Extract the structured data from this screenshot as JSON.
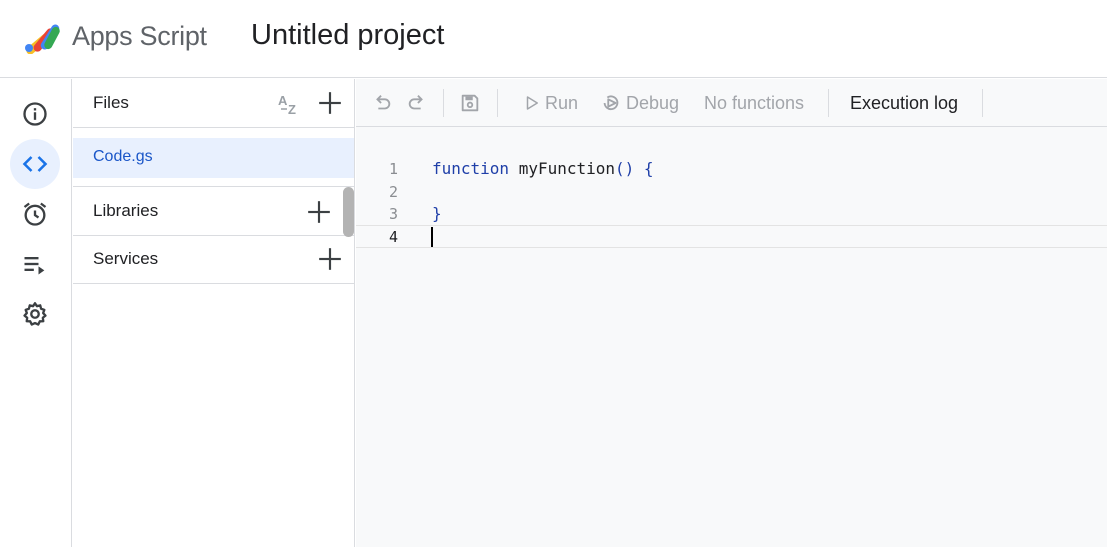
{
  "header": {
    "app_name": "Apps Script",
    "project_title": "Untitled project"
  },
  "rail": {
    "items": [
      {
        "name": "overview",
        "icon": "info-icon",
        "active": false
      },
      {
        "name": "editor",
        "icon": "code-icon",
        "active": true
      },
      {
        "name": "triggers",
        "icon": "alarm-clock-icon",
        "active": false
      },
      {
        "name": "executions",
        "icon": "executions-list-icon",
        "active": false
      },
      {
        "name": "settings",
        "icon": "gear-icon",
        "active": false
      }
    ]
  },
  "files_panel": {
    "files_label": "Files",
    "files": [
      {
        "name": "Code.gs",
        "selected": true
      }
    ],
    "libraries_label": "Libraries",
    "services_label": "Services"
  },
  "toolbar": {
    "run_label": "Run",
    "debug_label": "Debug",
    "function_select": "No functions",
    "execution_log_label": "Execution log"
  },
  "editor": {
    "lines": [
      {
        "num": "1",
        "kw1": "function",
        "text": " myFunction",
        "kw2": "() {"
      },
      {
        "num": "2",
        "kw1": "",
        "text": "",
        "kw2": ""
      },
      {
        "num": "3",
        "kw1": "}",
        "text": "",
        "kw2": ""
      },
      {
        "num": "4",
        "kw1": "",
        "text": "",
        "kw2": ""
      }
    ]
  },
  "colors": {
    "accent": "#1a73e8",
    "active_bg": "#e8f0fe",
    "editor_bg": "#f8f9fa",
    "keyword": "#1f3fa8"
  }
}
